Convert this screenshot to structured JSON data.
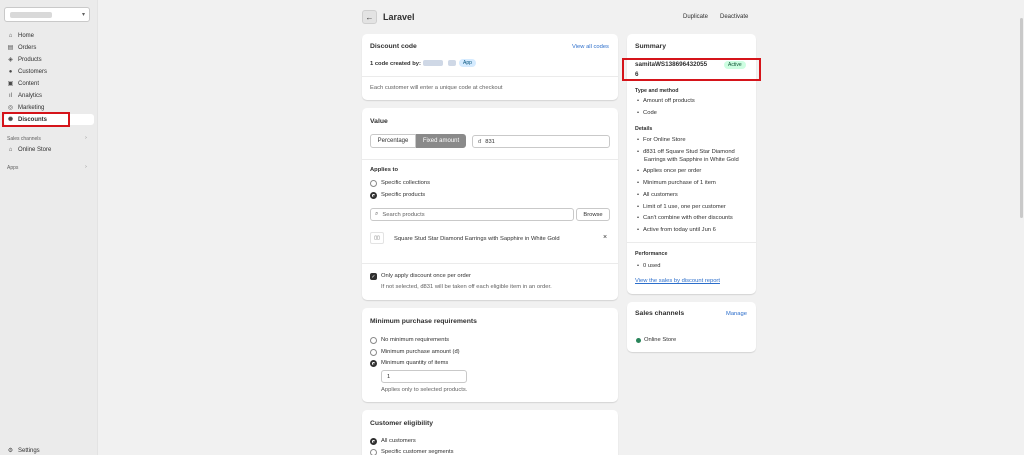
{
  "sidebar": {
    "nav": [
      {
        "label": "Home",
        "icon": "home-icon"
      },
      {
        "label": "Orders",
        "icon": "orders-icon"
      },
      {
        "label": "Products",
        "icon": "tag-icon"
      },
      {
        "label": "Customers",
        "icon": "person-icon"
      },
      {
        "label": "Content",
        "icon": "content-icon"
      },
      {
        "label": "Analytics",
        "icon": "chart-icon"
      },
      {
        "label": "Marketing",
        "icon": "target-icon"
      },
      {
        "label": "Discounts",
        "icon": "discount-icon"
      }
    ],
    "sales_channels_label": "Sales channels",
    "online_store": "Online Store",
    "apps_label": "Apps",
    "settings": "Settings"
  },
  "header": {
    "title": "Laravel",
    "duplicate": "Duplicate",
    "deactivate": "Deactivate"
  },
  "discount_code": {
    "title": "Discount code",
    "view_all": "View all codes",
    "created_by": "1 code created by:",
    "app_badge": "App",
    "note": "Each customer will enter a unique code at checkout"
  },
  "value": {
    "title": "Value",
    "percentage": "Percentage",
    "fixed_amount": "Fixed amount",
    "currency_symbol": "đ",
    "amount": "831",
    "applies_to": "Applies to",
    "specific_collections": "Specific collections",
    "specific_products": "Specific products",
    "search_placeholder": "Search products",
    "browse": "Browse",
    "product_thumb": "▯▯",
    "product_name": "Square Stud Star Diamond Earrings with Sapphire in White Gold",
    "once_per_order": "Only apply discount once per order",
    "once_per_order_help": "If not selected, đ831 will be taken off each eligible item in an order."
  },
  "min_purchase": {
    "title": "Minimum purchase requirements",
    "none": "No minimum requirements",
    "amount": "Minimum purchase amount (đ)",
    "quantity": "Minimum quantity of items",
    "quantity_value": "1",
    "help": "Applies only to selected products."
  },
  "eligibility": {
    "title": "Customer eligibility",
    "all": "All customers",
    "segments": "Specific customer segments"
  },
  "summary": {
    "title": "Summary",
    "code_line1": "samitaWS1386964320​55",
    "code_line2": "6",
    "status": "Active",
    "type_heading": "Type and method",
    "type_items": [
      "Amount off products",
      "Code"
    ],
    "details_heading": "Details",
    "details_items": [
      "For Online Store",
      "đ831 off Square Stud Star Diamond",
      "Applies once per order",
      "Minimum purchase of 1 item",
      "All customers",
      "Limit of 1 use, one per customer",
      "Can't combine with other discounts",
      "Active from today until Jun 6"
    ],
    "details_wrap": "Earrings with Sapphire in White Gold",
    "performance_heading": "Performance",
    "performance_items": [
      "0 used"
    ],
    "report_link": "View the sales by discount report"
  },
  "sales_channels": {
    "title": "Sales channels",
    "manage": "Manage",
    "channel": "Online Store"
  },
  "colors": {
    "highlight": "#d5141a",
    "active_badge_bg": "#cdfee1",
    "active_badge_text": "#0c5132",
    "link": "#2c6ecb",
    "app_badge_bg": "#d5ebff"
  }
}
